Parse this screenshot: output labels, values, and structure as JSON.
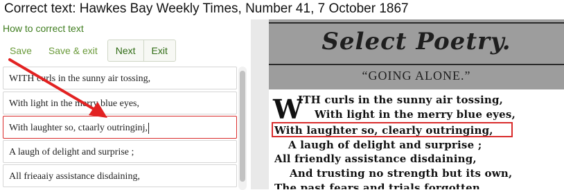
{
  "header": {
    "title": "Correct text: Hawkes Bay Weekly Times, Number 41, 7 October 1867"
  },
  "help": {
    "link_label": "How to correct text"
  },
  "toolbar": {
    "save_label": "Save",
    "save_exit_label": "Save & exit",
    "next_label": "Next",
    "exit_label": "Exit"
  },
  "lines": [
    {
      "value": "WITH curls in the sunny air tossing,"
    },
    {
      "value": "With light in the merry blue eyes,"
    },
    {
      "value": "With laughter so, ctaarly outringinj,"
    },
    {
      "value": "A laugh of delight and surprise ;"
    },
    {
      "value": "All frieaaiy assistance disdaining,"
    }
  ],
  "scan": {
    "banner": "Select Poetry.",
    "subhead": "“GOING ALONE.”",
    "dropcap": "W",
    "lines": [
      "ITH curls in the sunny air tossing,",
      "With light in the merry blue eyes,",
      "With laughter so, clearly outringing,",
      "A laugh of delight and surprise ;",
      "All friendly assistance disdaining,",
      "And trusting no strength but its own,",
      "The past fears and trials forgotten,"
    ]
  },
  "colors": {
    "accent_green": "#3f7d1f",
    "highlight_red": "#d92b2b",
    "scan_gray": "#9d9d9d"
  },
  "icons": {
    "annotation": "red-arrow-icon"
  }
}
